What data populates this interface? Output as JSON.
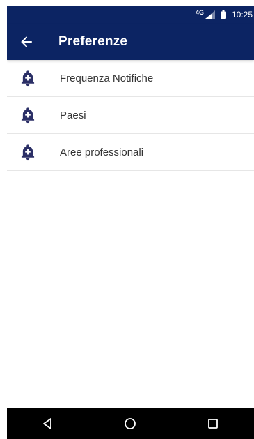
{
  "colors": {
    "primary": "#0c2463",
    "icon": "#2b2f66",
    "text": "#333333",
    "divider": "#e6e6e6",
    "nav_bar": "#000000"
  },
  "status_bar": {
    "network": "4G",
    "time": "10:25",
    "icons": [
      "signal-icon",
      "battery-icon"
    ]
  },
  "app_bar": {
    "title": "Preferenze",
    "back_icon": "arrow-left-icon"
  },
  "list": {
    "items": [
      {
        "label": "Frequenza Notifiche",
        "icon": "bell-plus-icon"
      },
      {
        "label": "Paesi",
        "icon": "bell-plus-icon"
      },
      {
        "label": "Aree professionali",
        "icon": "bell-plus-icon"
      }
    ]
  },
  "nav_bar": {
    "buttons": [
      "back-triangle-icon",
      "home-circle-icon",
      "recents-square-icon"
    ]
  }
}
